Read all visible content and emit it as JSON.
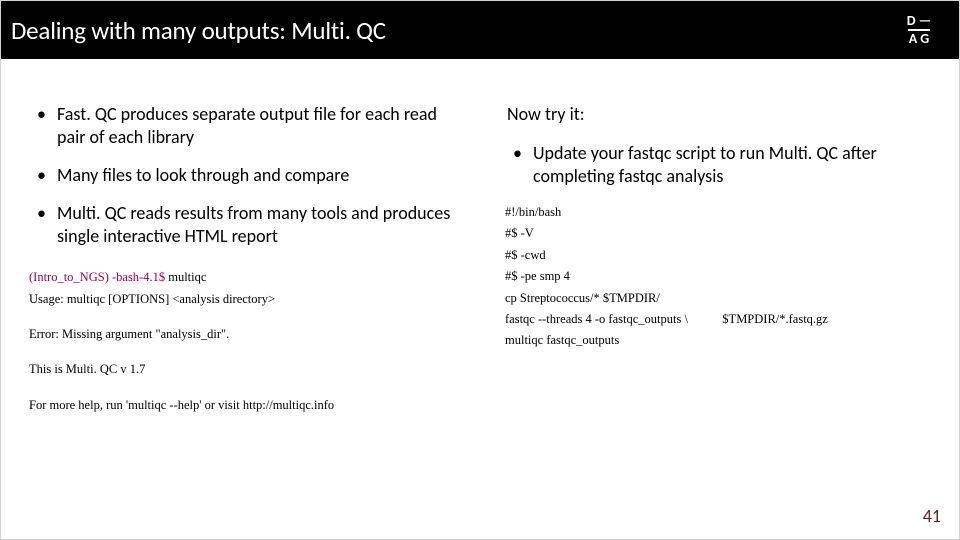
{
  "header": {
    "title": "Dealing with many outputs: Multi. QC",
    "logo": {
      "tl": "D",
      "tr": "—",
      "bl": "A",
      "br": "G"
    }
  },
  "left": {
    "points": [
      "Fast. QC produces separate output file for each read pair of each library",
      "Many files to look through and compare",
      "Multi. QC reads results from many tools and produces single interactive HTML report"
    ],
    "terminal": {
      "prompt": "(Intro_to_NGS) -bash-4.1$ ",
      "cmd": "multiqc",
      "usage": "Usage: multiqc [OPTIONS] <analysis directory>",
      "error": "Error: Missing argument \"analysis_dir\".",
      "version": "This is Multi. QC v 1.7",
      "help": "For more help, run 'multiqc --help' or visit http://multiqc.info"
    }
  },
  "right": {
    "now_try": "Now try it:",
    "task": "Update your fastqc script to run Multi. QC after completing fastqc analysis",
    "script": [
      "#!/bin/bash",
      "",
      "#$ -V",
      "#$ -cwd",
      "#$ -pe smp 4",
      "",
      "",
      "cp Streptococcus/* $TMPDIR/",
      "fastqc --threads 4 -o fastqc_outputs \\           $TMPDIR/*.fastq.gz",
      "multiqc fastqc_outputs"
    ]
  },
  "page_number": "41"
}
